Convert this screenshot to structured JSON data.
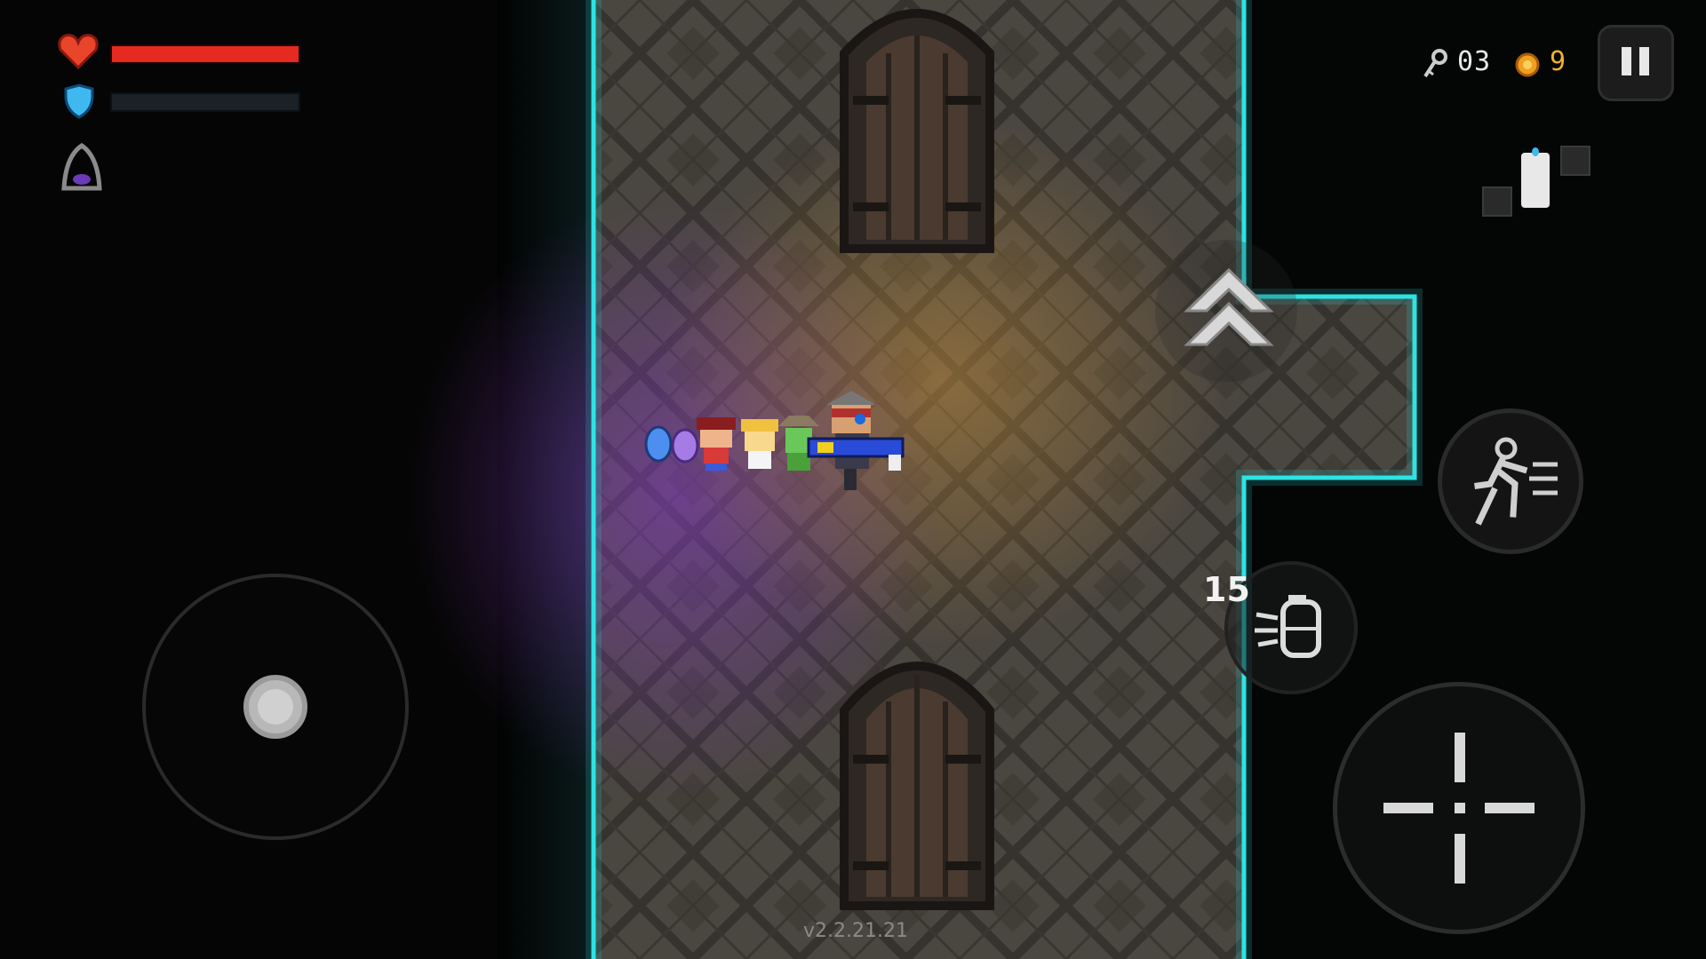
{
  "hud": {
    "health": {
      "fraction": 1.0,
      "color": "#e52b1f",
      "icon": "heart-icon"
    },
    "armor": {
      "fraction": 0.0,
      "color": "#3fb8f0",
      "icon": "shield-icon"
    },
    "buff_icon": "hooded-figure-icon",
    "keys": {
      "icon": "key-icon",
      "value": "03"
    },
    "coins": {
      "icon": "coin-icon",
      "value": "9"
    },
    "pause_icon": "pause-icon"
  },
  "minimap": {
    "icon": "minimap-icon"
  },
  "controls": {
    "joystick": "virtual-joystick",
    "dash_icon": "double-chevron-up-icon",
    "sprint_icon": "running-figure-icon",
    "grenade": {
      "icon": "grenade-icon",
      "count": "15"
    },
    "fire_icon": "crosshair-icon"
  },
  "world": {
    "accent_color": "#2fe3e3",
    "floor_color": "#4a4640",
    "party": [
      "blue-egg",
      "purple-egg",
      "red-haired-pet",
      "blonde-pet",
      "green-goblin-pet",
      "knight-with-blaster"
    ]
  },
  "version": "v2.2.21.21"
}
